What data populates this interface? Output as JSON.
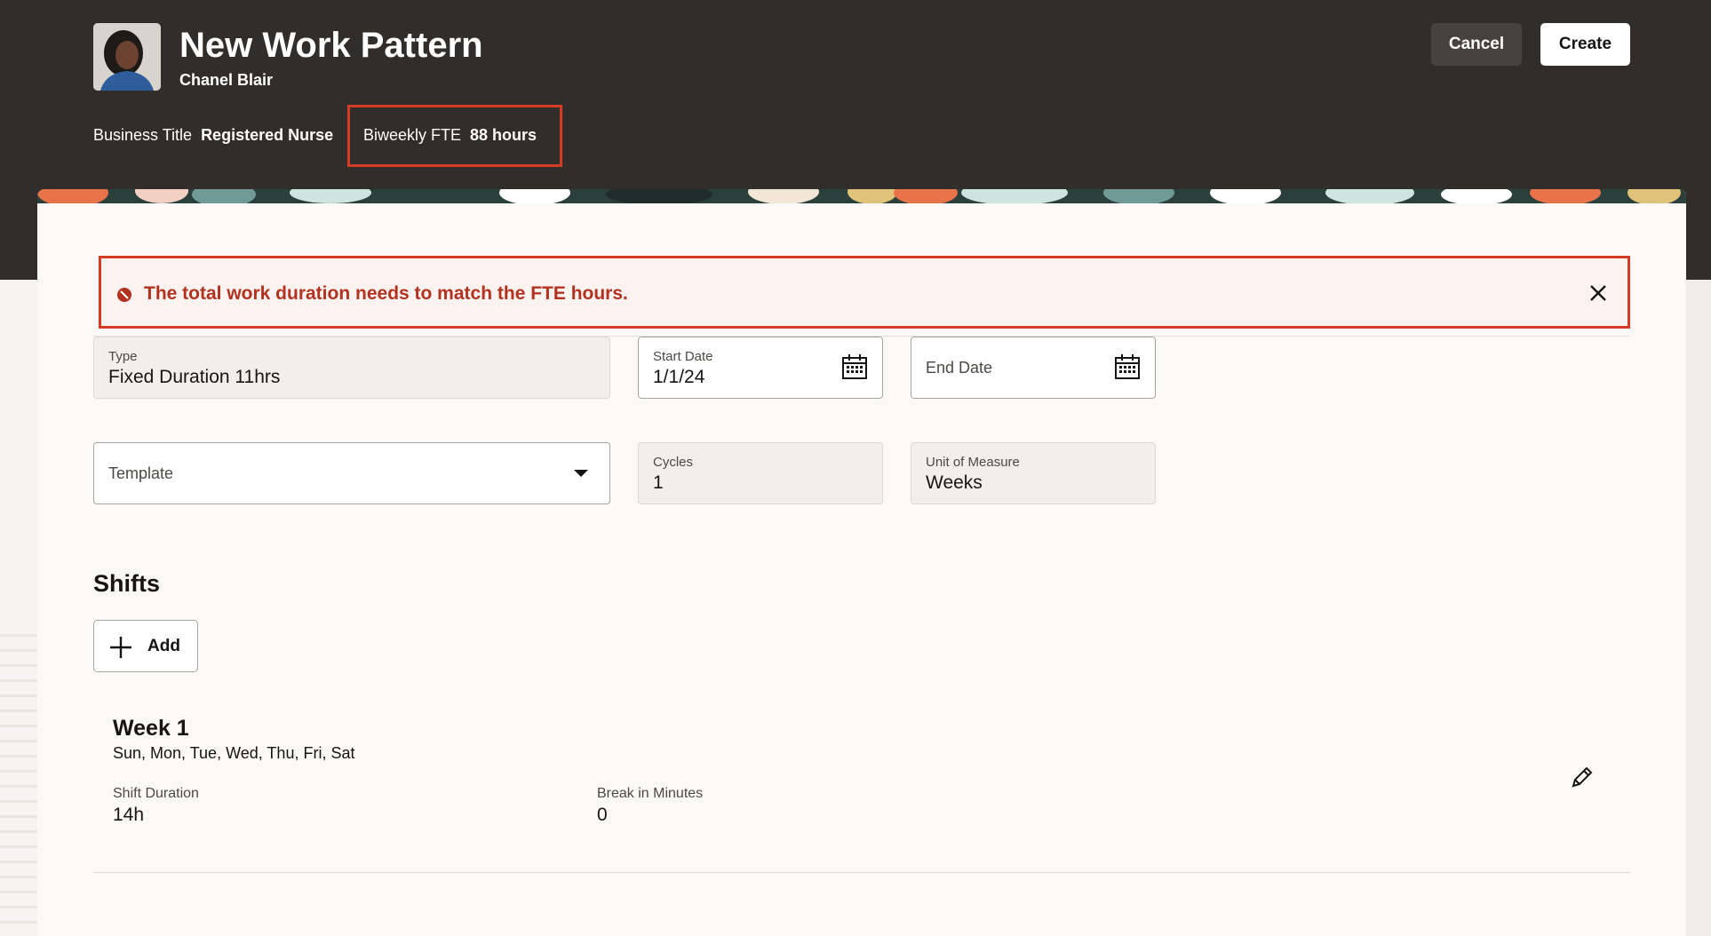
{
  "header": {
    "title": "New Work Pattern",
    "person_name": "Chanel Blair",
    "cancel_label": "Cancel",
    "create_label": "Create",
    "business_title_label": "Business Title",
    "business_title_value": "Registered Nurse",
    "fte_label": "Biweekly FTE",
    "fte_value": "88 hours"
  },
  "error": {
    "message": "The total work duration needs to match the FTE hours.",
    "icon": "error-circle-icon",
    "close_icon": "close-icon"
  },
  "form": {
    "type_label": "Type",
    "type_value": "Fixed Duration 11hrs",
    "start_date_label": "Start Date",
    "start_date_value": "1/1/24",
    "end_date_placeholder": "End Date",
    "template_placeholder": "Template",
    "cycles_label": "Cycles",
    "cycles_value": "1",
    "uom_label": "Unit of Measure",
    "uom_value": "Weeks"
  },
  "shifts": {
    "heading": "Shifts",
    "add_label": "Add",
    "weeks": [
      {
        "title": "Week 1",
        "days": "Sun, Mon, Tue, Wed, Thu, Fri, Sat",
        "shift_duration_label": "Shift Duration",
        "shift_duration_value": "14h",
        "break_label": "Break in Minutes",
        "break_value": "0"
      }
    ]
  },
  "colors": {
    "header_bg": "#312d2a",
    "error_border": "#d63b25",
    "error_text": "#b3311f",
    "card_bg": "#fbf9f8"
  }
}
